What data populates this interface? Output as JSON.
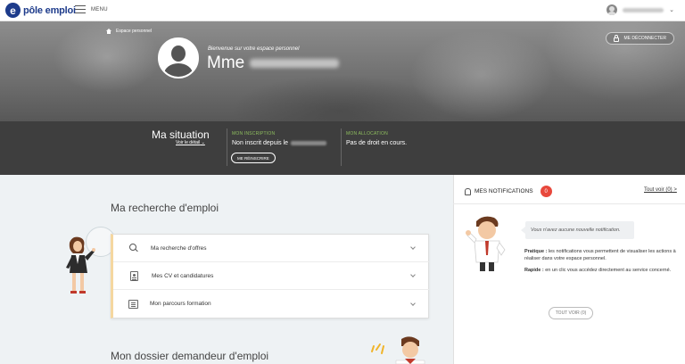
{
  "topbar": {
    "logo_text": "pôle emploi",
    "menu_label": "MENU"
  },
  "hero": {
    "breadcrumb": "Espace personnel",
    "logout_label": "ME DÉCONNECTER",
    "welcome": "Bienvenue sur votre espace personnel",
    "title_prefix": "Mme"
  },
  "situation": {
    "title": "Ma situation",
    "details_link": "Voir le détail",
    "inscription_label": "MON INSCRIPTION",
    "inscription_text": "Non inscrit depuis le",
    "reinscrire_label": "ME RÉINSCRIRE",
    "allocation_label": "MON ALLOCATION",
    "allocation_text": "Pas de droit en cours."
  },
  "recherche": {
    "title": "Ma recherche d'emploi",
    "items": [
      {
        "label": "Ma recherche d'offres",
        "icon": "search-icon"
      },
      {
        "label": "Mes CV et candidatures",
        "icon": "cv-icon"
      },
      {
        "label": "Mon parcours formation",
        "icon": "training-icon"
      }
    ]
  },
  "dossier": {
    "title": "Mon dossier demandeur d'emploi"
  },
  "notifications": {
    "title": "MES NOTIFICATIONS",
    "count": "0",
    "see_all_link": "Tout voir (0) >",
    "empty_message": "Vous n'avez aucune nouvelle notification.",
    "pratique_label": "Pratique :",
    "pratique_text": "les notifications vous permettent de visualiser les actions à réaliser dans votre espace personnel.",
    "rapide_label": "Rapide :",
    "rapide_text": "en un clic vous accédez directement au service concerné.",
    "see_all_button": "TOUT VOIR (0)"
  },
  "colors": {
    "brand": "#1d3b8b",
    "badge": "#e8483c",
    "label_green": "#8fbf5f",
    "dark_band": "#3e3e3e"
  }
}
